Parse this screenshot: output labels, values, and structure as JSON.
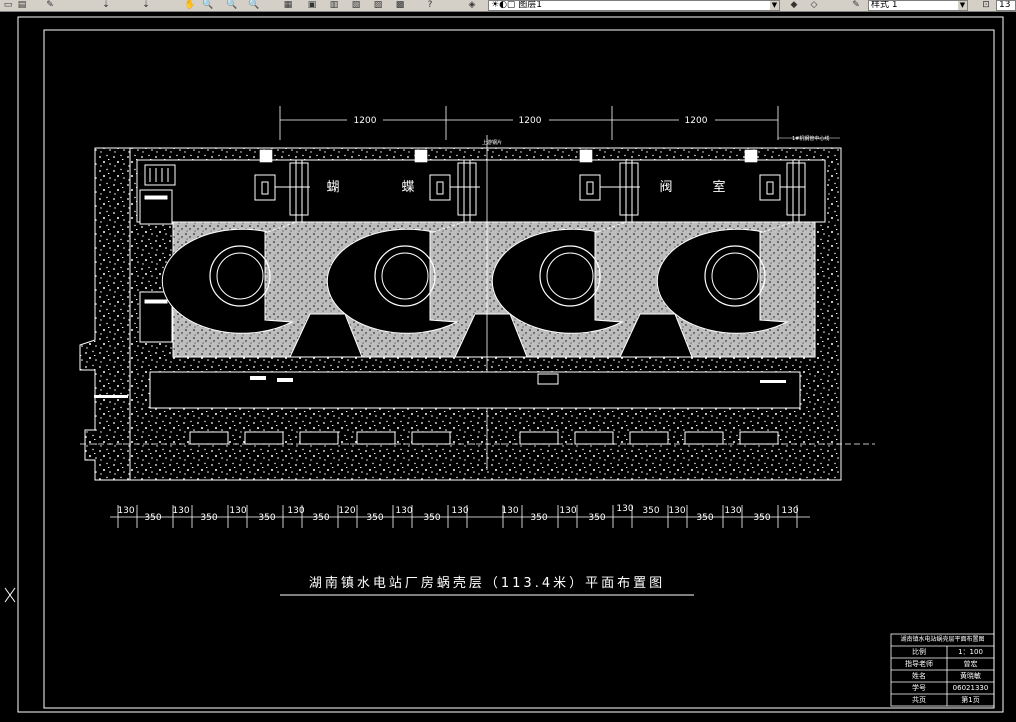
{
  "toolbar": {
    "layer_name": "图层1",
    "style_name": "样式 1",
    "extra_value": "13"
  },
  "drawing": {
    "title": "湖南镇水电站厂房蜗壳层（113.4米）平面布置图",
    "room_label_chars": [
      "蝴",
      "蝶",
      "阀",
      "室"
    ],
    "top_dims": [
      "1200",
      "1200",
      "1200"
    ],
    "bottom_dims": [
      "130",
      "350",
      "130",
      "350",
      "130",
      "350",
      "130",
      "350",
      "120",
      "350",
      "130",
      "350",
      "130",
      "130",
      "350",
      "130",
      "350",
      "130",
      "350",
      "130",
      "350",
      "130",
      "350",
      "130"
    ],
    "small_notes": [
      "上游钢片",
      "1#机钢管中心线"
    ]
  },
  "title_block": {
    "header": "湖南镇水电站蜗壳层平面布置图",
    "rows": [
      {
        "label": "比例",
        "value": "1：100"
      },
      {
        "label": "指导老师",
        "value": "曾宏"
      },
      {
        "label": "姓名",
        "value": "黄晓敏"
      },
      {
        "label": "学号",
        "value": "06021330"
      },
      {
        "label": "共页",
        "value": "第1页"
      }
    ]
  }
}
